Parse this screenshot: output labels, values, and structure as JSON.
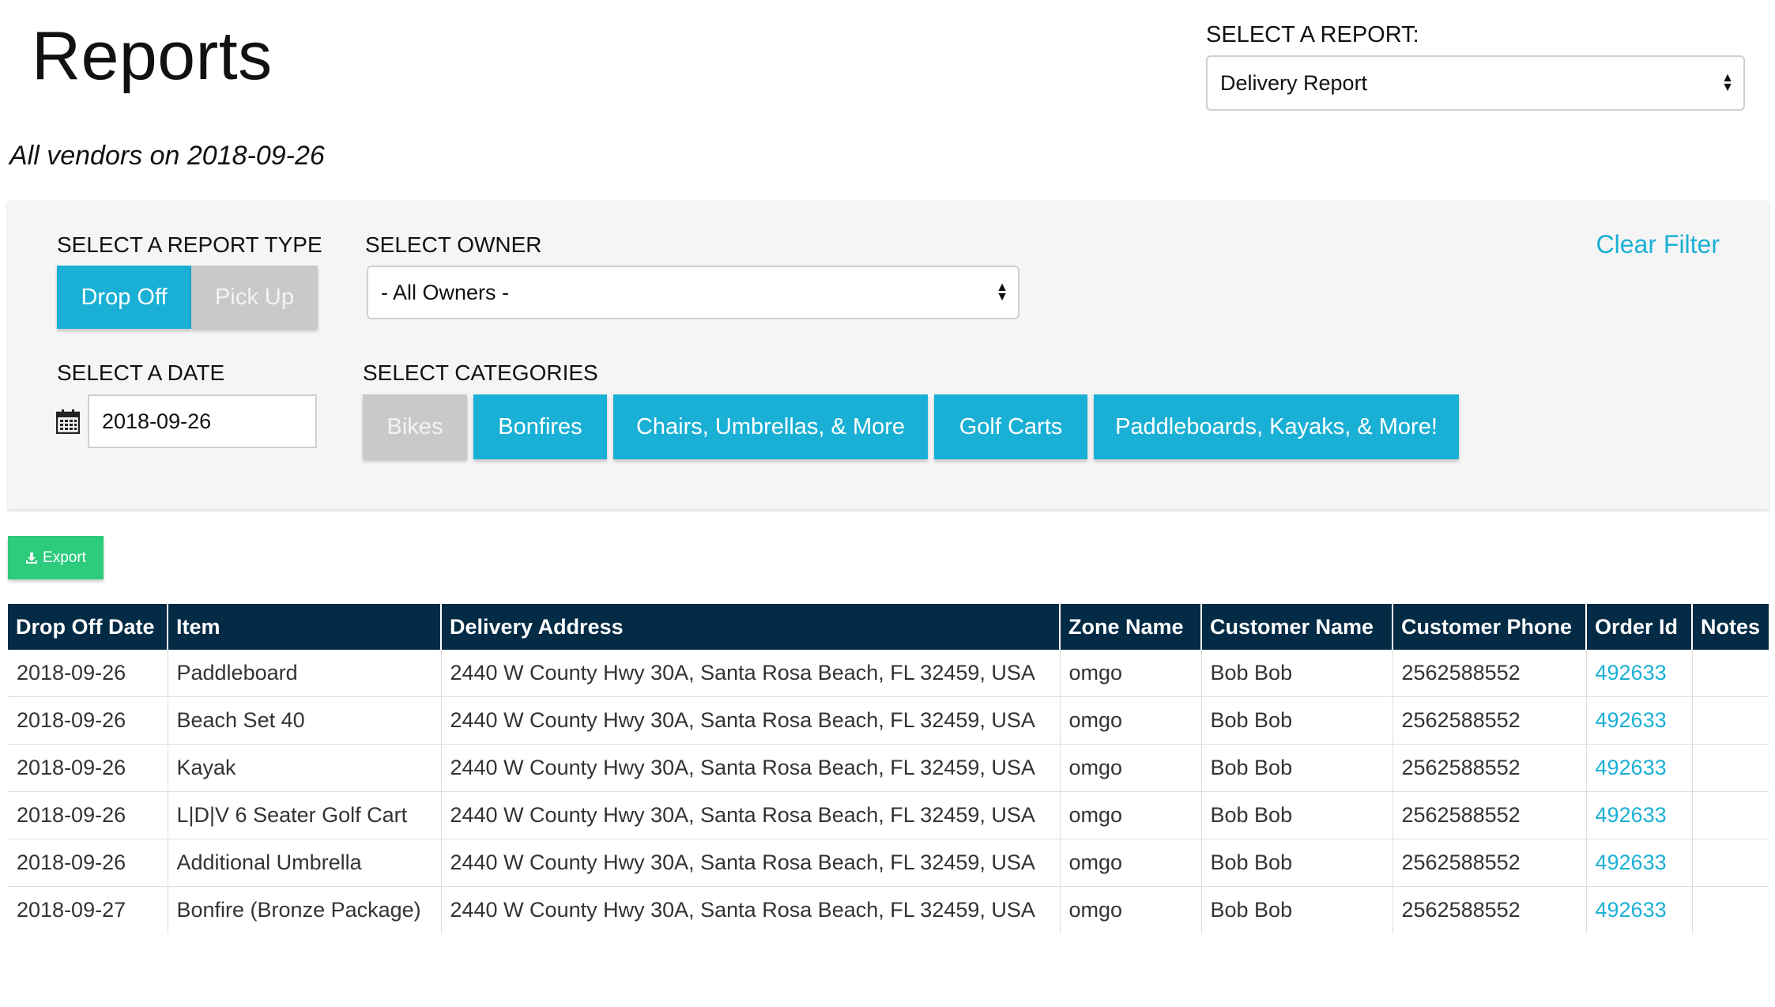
{
  "header": {
    "title": "Reports",
    "subtitle": "All vendors on 2018-09-26",
    "report_select_label": "SELECT A REPORT:",
    "report_select_value": "Delivery Report"
  },
  "filters": {
    "report_type_label": "SELECT A REPORT TYPE",
    "report_types": [
      {
        "label": "Drop Off",
        "active": true
      },
      {
        "label": "Pick Up",
        "active": false
      }
    ],
    "owner_label": "SELECT OWNER",
    "owner_value": "- All Owners -",
    "clear_filter": "Clear Filter",
    "date_label": "SELECT A DATE",
    "date_value": "2018-09-26",
    "categories_label": "SELECT CATEGORIES",
    "categories": [
      {
        "label": "Bikes",
        "active": false
      },
      {
        "label": "Bonfires",
        "active": true
      },
      {
        "label": "Chairs, Umbrellas, & More",
        "active": true
      },
      {
        "label": "Golf Carts",
        "active": true
      },
      {
        "label": "Paddleboards, Kayaks, & More!",
        "active": true
      }
    ]
  },
  "export_label": "Export",
  "table": {
    "headers": [
      "Drop Off Date",
      "Item",
      "Delivery Address",
      "Zone Name",
      "Customer Name",
      "Customer Phone",
      "Order Id",
      "Notes"
    ],
    "rows": [
      [
        "2018-09-26",
        "Paddleboard",
        "2440 W County Hwy 30A, Santa Rosa Beach, FL 32459, USA",
        "omgo",
        "Bob Bob",
        "2562588552",
        "492633",
        ""
      ],
      [
        "2018-09-26",
        "Beach Set 40",
        "2440 W County Hwy 30A, Santa Rosa Beach, FL 32459, USA",
        "omgo",
        "Bob Bob",
        "2562588552",
        "492633",
        ""
      ],
      [
        "2018-09-26",
        "Kayak",
        "2440 W County Hwy 30A, Santa Rosa Beach, FL 32459, USA",
        "omgo",
        "Bob Bob",
        "2562588552",
        "492633",
        ""
      ],
      [
        "2018-09-26",
        "L|D|V 6 Seater Golf Cart",
        "2440 W County Hwy 30A, Santa Rosa Beach, FL 32459, USA",
        "omgo",
        "Bob Bob",
        "2562588552",
        "492633",
        ""
      ],
      [
        "2018-09-26",
        "Additional Umbrella",
        "2440 W County Hwy 30A, Santa Rosa Beach, FL 32459, USA",
        "omgo",
        "Bob Bob",
        "2562588552",
        "492633",
        ""
      ],
      [
        "2018-09-27",
        "Bonfire (Bronze Package)",
        "2440 W County Hwy 30A, Santa Rosa Beach, FL 32459, USA",
        "omgo",
        "Bob Bob",
        "2562588552",
        "492633",
        ""
      ]
    ]
  },
  "colors": {
    "accent": "#1ab0d5",
    "inactive": "#c9c9c9",
    "export": "#2ccc7c",
    "table_header": "#042b45"
  }
}
